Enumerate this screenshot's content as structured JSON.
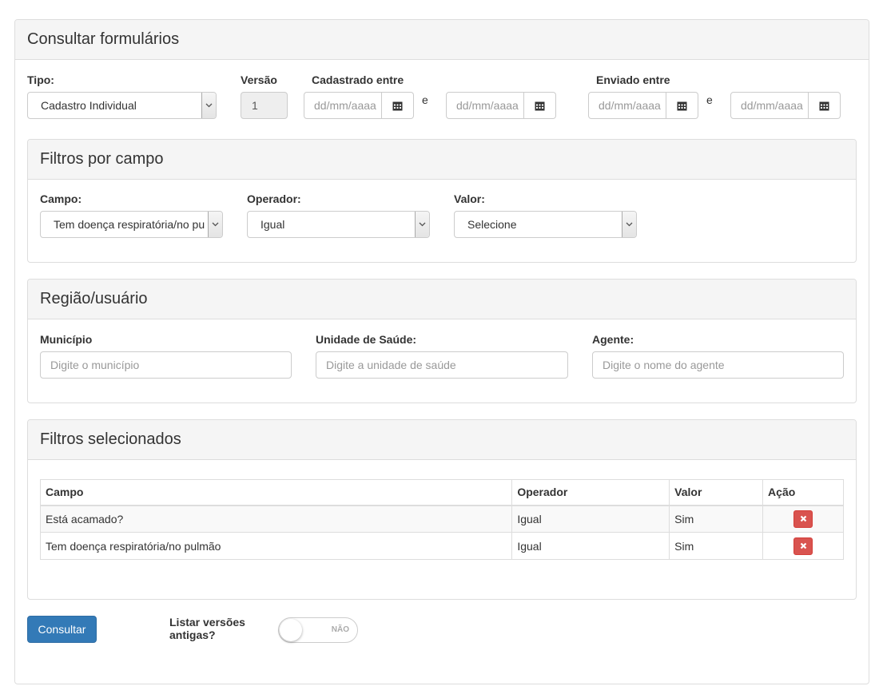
{
  "page": {
    "title": "Consultar formulários"
  },
  "top_form": {
    "tipo_label": "Tipo:",
    "tipo_value": "Cadastro Individual",
    "versao_label": "Versão",
    "versao_value": "1",
    "cadastrado_label": "Cadastrado entre",
    "enviado_label": "Enviado entre",
    "date_placeholder": "dd/mm/aaaa",
    "between_sep": "e"
  },
  "filtros_campo": {
    "title": "Filtros por campo",
    "campo_label": "Campo:",
    "campo_value": "Tem doença respiratória/no pulmão",
    "operador_label": "Operador:",
    "operador_value": "Igual",
    "valor_label": "Valor:",
    "valor_value": "Selecione"
  },
  "regiao": {
    "title": "Região/usuário",
    "municipio_label": "Município",
    "municipio_placeholder": "Digite o município",
    "unidade_label": "Unidade de Saúde:",
    "unidade_placeholder": "Digite a unidade de saúde",
    "agente_label": "Agente:",
    "agente_placeholder": "Digite o nome do agente"
  },
  "filtros_selecionados": {
    "title": "Filtros selecionados",
    "columns": [
      "Campo",
      "Operador",
      "Valor",
      "Ação"
    ],
    "rows": [
      {
        "campo": "Está acamado?",
        "operador": "Igual",
        "valor": "Sim"
      },
      {
        "campo": "Tem doença respiratória/no pulmão",
        "operador": "Igual",
        "valor": "Sim"
      }
    ]
  },
  "footer": {
    "consultar_label": "Consultar",
    "listar_label_line1": "Listar versões",
    "listar_label_line2": "antigas?",
    "toggle_off_text": "NÃO"
  },
  "icons": {
    "calendar": "calendar-icon",
    "chevron": "chevron-down-icon",
    "remove": "close-icon"
  },
  "colors": {
    "primary": "#337ab7",
    "danger": "#d9534f",
    "panel_heading_bg": "#f5f5f5"
  }
}
